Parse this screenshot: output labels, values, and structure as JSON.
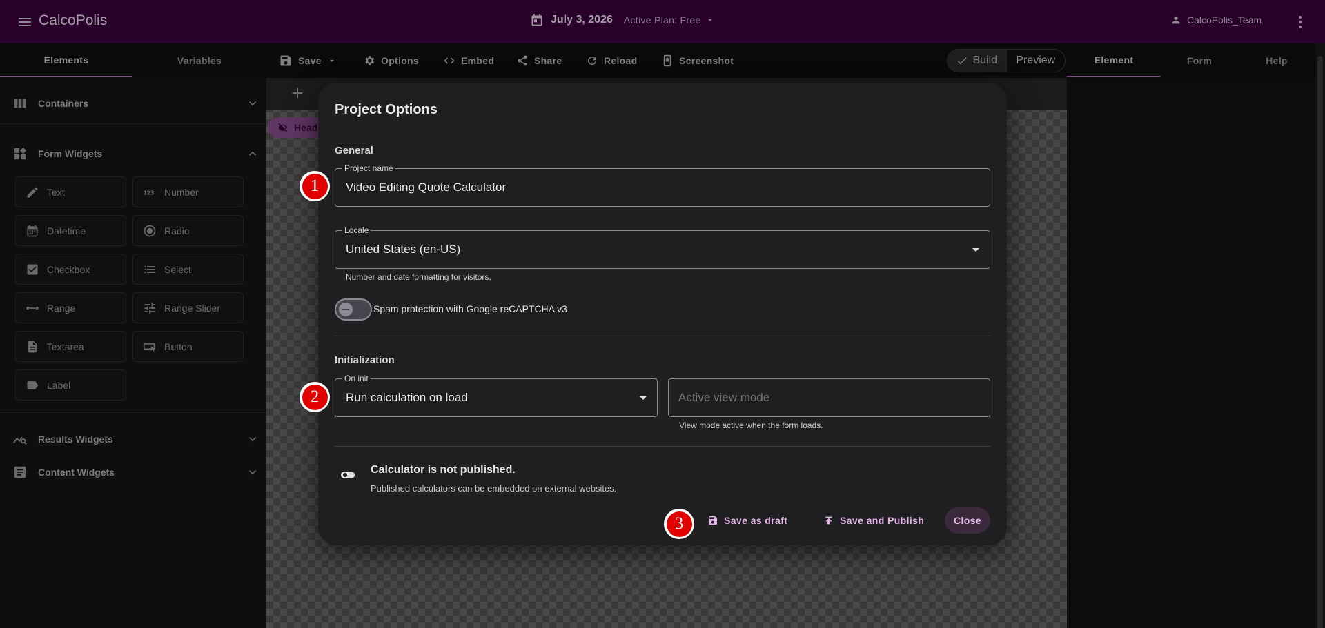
{
  "app": {
    "title": "CalcoPolis",
    "date": "July 3, 2026",
    "plan": "Active Plan: Free",
    "user": "CalcoPolis_Team"
  },
  "left_tabs": [
    {
      "label": "Elements",
      "active": true
    },
    {
      "label": "Variables",
      "active": false
    }
  ],
  "toolbar": {
    "save": "Save",
    "options": "Options",
    "embed": "Embed",
    "share": "Share",
    "reload": "Reload",
    "screenshot": "Screenshot"
  },
  "mode": {
    "build": "Build",
    "preview": "Preview",
    "selected": "Build"
  },
  "right_tabs": [
    {
      "label": "Element",
      "active": true
    },
    {
      "label": "Form",
      "active": false
    },
    {
      "label": "Help",
      "active": false
    }
  ],
  "sidebar": {
    "containers": {
      "label": "Containers",
      "icon": "columns-icon",
      "expanded": false
    },
    "form_widgets": {
      "label": "Form Widgets",
      "icon": "widgets-icon",
      "expanded": true,
      "items": [
        {
          "label": "Text",
          "icon": "pencil-icon"
        },
        {
          "label": "Number",
          "icon": "number-123-icon"
        },
        {
          "label": "Datetime",
          "icon": "calendar-icon"
        },
        {
          "label": "Radio",
          "icon": "radio-icon"
        },
        {
          "label": "Checkbox",
          "icon": "checkbox-icon"
        },
        {
          "label": "Select",
          "icon": "list-icon"
        },
        {
          "label": "Range",
          "icon": "range-dots-icon"
        },
        {
          "label": "Range Slider",
          "icon": "sliders-icon"
        },
        {
          "label": "Textarea",
          "icon": "document-icon"
        },
        {
          "label": "Button",
          "icon": "button-cursor-icon"
        },
        {
          "label": "Label",
          "icon": "label-tag-icon"
        }
      ]
    },
    "results_widgets": {
      "label": "Results Widgets",
      "icon": "chart-search-icon",
      "expanded": false
    },
    "content_widgets": {
      "label": "Content Widgets",
      "icon": "article-icon",
      "expanded": false
    }
  },
  "canvas": {
    "chip_label": "Header"
  },
  "dialog": {
    "title": "Project Options",
    "general": "General",
    "project_name": {
      "label": "Project name",
      "value": "Video Editing Quote Calculator"
    },
    "locale": {
      "label": "Locale",
      "value": "United States (en-US)",
      "hint": "Number and date formatting for visitors."
    },
    "spam": {
      "label": "Spam protection with Google reCAPTCHA v3",
      "on": false
    },
    "initialization": "Initialization",
    "on_init": {
      "label": "On init",
      "value": "Run calculation on load"
    },
    "view_mode": {
      "placeholder": "Active view mode",
      "hint": "View mode active when the form loads."
    },
    "publish": {
      "title": "Calculator is not published.",
      "subtitle": "Published calculators can be embedded on external websites."
    },
    "buttons": {
      "draft": "Save as draft",
      "publish": "Save and Publish",
      "close": "Close"
    }
  },
  "markers": [
    "1",
    "2",
    "3"
  ],
  "colors": {
    "top_bar": "#3b0440",
    "accent": "#e3b6e7",
    "marker_red": "#e00000"
  }
}
